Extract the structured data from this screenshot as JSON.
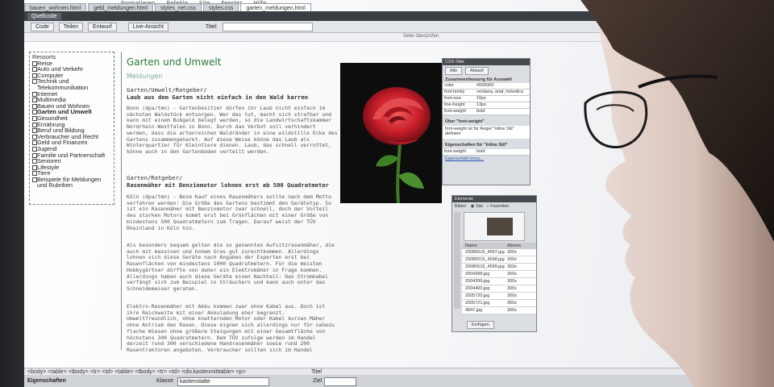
{
  "menubar": {
    "items": [
      "Formatieren",
      "Befehle",
      "Site",
      "Fenster",
      "Hilfe"
    ]
  },
  "tabs": [
    "bauen_wohnen.html",
    "geld_meldungen.html",
    "styles_net.css",
    "styles.css",
    "garten_meldungen.html"
  ],
  "toolbar": {
    "quellcode": "Quellcode",
    "code": "Code",
    "teilen": "Teilen",
    "entwurf": "Entwurf",
    "live": "Live-Ansicht",
    "titel_label": "Titel:"
  },
  "subbar": {
    "right": "Seite überprüfen"
  },
  "nav": {
    "heading": "Ressorts",
    "items": [
      {
        "label": "Reise",
        "bold": false
      },
      {
        "label": "Auto und Verkehr",
        "bold": false
      },
      {
        "label": "Computer",
        "bold": false
      },
      {
        "label": "Technik und Telekommunikation",
        "bold": false
      },
      {
        "label": "Internet",
        "bold": false
      },
      {
        "label": "Multimedia",
        "bold": false
      },
      {
        "label": "Bauen und Wohnen",
        "bold": false
      },
      {
        "label": "Garten und Umwelt",
        "bold": true
      },
      {
        "label": "Gesundheit",
        "bold": false
      },
      {
        "label": "Ernährung",
        "bold": false
      },
      {
        "label": "Beruf und Bildung",
        "bold": false
      },
      {
        "label": "Verbraucher und Recht",
        "bold": false
      },
      {
        "label": "Geld und Finanzen",
        "bold": false
      },
      {
        "label": "Jugend",
        "bold": false
      },
      {
        "label": "Familie und Partnerschaft",
        "bold": false
      },
      {
        "label": "Senioren",
        "bold": false
      },
      {
        "label": "Lifestyle",
        "bold": false
      },
      {
        "label": "Tiere",
        "bold": false
      },
      {
        "label": "Beispiele für Meldungen und Rubriken",
        "bold": false
      }
    ]
  },
  "content": {
    "title": "Garten und Umwelt",
    "subtitle": "Meldungen",
    "article1": {
      "crumb": "Garten/Umwelt/Ratgeber/",
      "headline": "Laub aus dem Garten nicht einfach in den Wald karren",
      "body": "Bonn (dpa/tmn) - Gartenbesitzer dürfen ihr Laub nicht einfach im nächsten Waldstück entsorgen. Wer das tut, macht sich strafbar und kann mit einem Bußgeld belegt werden, so die Landwirtschaftskammer Nordrhein-Westfalen in Bonn. Durch das Verbot soll verhindert werden, dass die artenreichen Waldränder in eine wildstille Ecke des Gartens zusammengeharkt. Auf diese Weise könne das Laub als Winterquartier für Kleintiere dienen. Laub, das schnell verrottet, könne auch in den Gartenboden verteilt werden."
    },
    "article2": {
      "crumb": "Garten/Ratgeber/",
      "headline": "Rasenmäher mit Benzinmotor lohnen erst ab 500 Quadratmeter",
      "body1": "Köln (dpa/tmn) - Beim Kauf eines Rasenmähers sollte nach dem Motto verfahren werden: Die Größe des Gartens bestimmt den Gerätetyp. So ist ein Rasenmäher mit Benzinmotor zwar schnell, doch der Vorteil des starken Motors kommt erst bei Grünflächen mit einer Größe von mindestens 500 Quadratmetern zum Tragen. Darauf weist der TÜV Rheinland in Köln hin.",
      "body2": "Als besonders bequem gelten die so genannten Aufsitzrasenmäher, die auch mit massiven und hohem Gras gut zurechtkommen. Allerdings lohnen sich diese Geräte nach Angaben der Experten erst bei Rasenflächen von mindestens 1000 Quadratmetern. Für die meisten Hobbygärtner dürfte von daher ein Elektromäher in Frage kommen. Allerdings haben auch diese Geräte einen Nachteil: Das Stromkabel verfängt sich zum Beispiel in Sträuchern und kann auch unter das Schneidemesser geraten.",
      "body3": "Elektro-Rasenmäher mit Akku kommen zwar ohne Kabel aus. Doch ist ihre Reichweite mit einer Akkuladung eher begrenzt. Umweltfreundlich, ohne knatternden Motor oder Kabel kurzen Mäher ohne Antrieb den Rasen. Diese eignen sich allerdings nur für nahezu flache Wiesen ohne größere Steigungen mit einer Gesamtfläche von höchstens 300 Quadratmetern. Dem TÜV zufolge werden im Handel derzeit rund 300 verschiedene Handrasenmäher sowie rund 200 Rasentraktoren angeboten. Verbraucher sollten sich im Handel ausführlich beraten lassen."
    }
  },
  "css_panel": {
    "title": "CSS-Stile",
    "tabs": [
      "Alle",
      "Aktuell"
    ],
    "summary_title": "Zusammenfassung für Auswahl",
    "rows": [
      [
        "color",
        "#000000"
      ],
      [
        "font-family",
        "verdana, arial, helvetica"
      ],
      [
        "font-size",
        "10px"
      ],
      [
        "line-height",
        "13px"
      ],
      [
        "font-weight",
        "bold"
      ]
    ],
    "info_title": "Über \"font-weight\"",
    "info_text": "font-weight ist für Regel \"Inline Stil\" definiert",
    "props_title": "Eigenschaften für \"Inline Stil\"",
    "prop_key": "font-weight",
    "prop_val": "bold",
    "add_link": "Eigenschaft hinzu..."
  },
  "assets_panel": {
    "title": "Elemente",
    "view_label": "Bilder:",
    "opt1": "Site",
    "opt2": "Favoriten",
    "col_name": "Name",
    "col_size": "Abmes",
    "files": [
      [
        "20080515_4597.jpg",
        "300x"
      ],
      [
        "20080515_4598.jpg",
        "300x"
      ],
      [
        "20080515_4599.jpg",
        "300x"
      ],
      [
        "2004398.jpg",
        "300x"
      ],
      [
        "2004399.jpg",
        "300x"
      ],
      [
        "2004400.jpg",
        "300x"
      ],
      [
        "2005720.jpg",
        "300x"
      ],
      [
        "2005721.jpg",
        "300x"
      ],
      [
        "4847.jpg",
        "300x"
      ]
    ],
    "insert_btn": "Einfügen"
  },
  "status": {
    "tags": "<body> <table> <tbody> <tr> <td> <table> <tbody> <tr> <td> <div.kastenmitttable> <p>"
  },
  "props": {
    "label": "Eigenschaften",
    "klasse": "Klasse",
    "klasse_val": "kastenstatte",
    "titel": "Titel",
    "ziel": "Ziel"
  }
}
